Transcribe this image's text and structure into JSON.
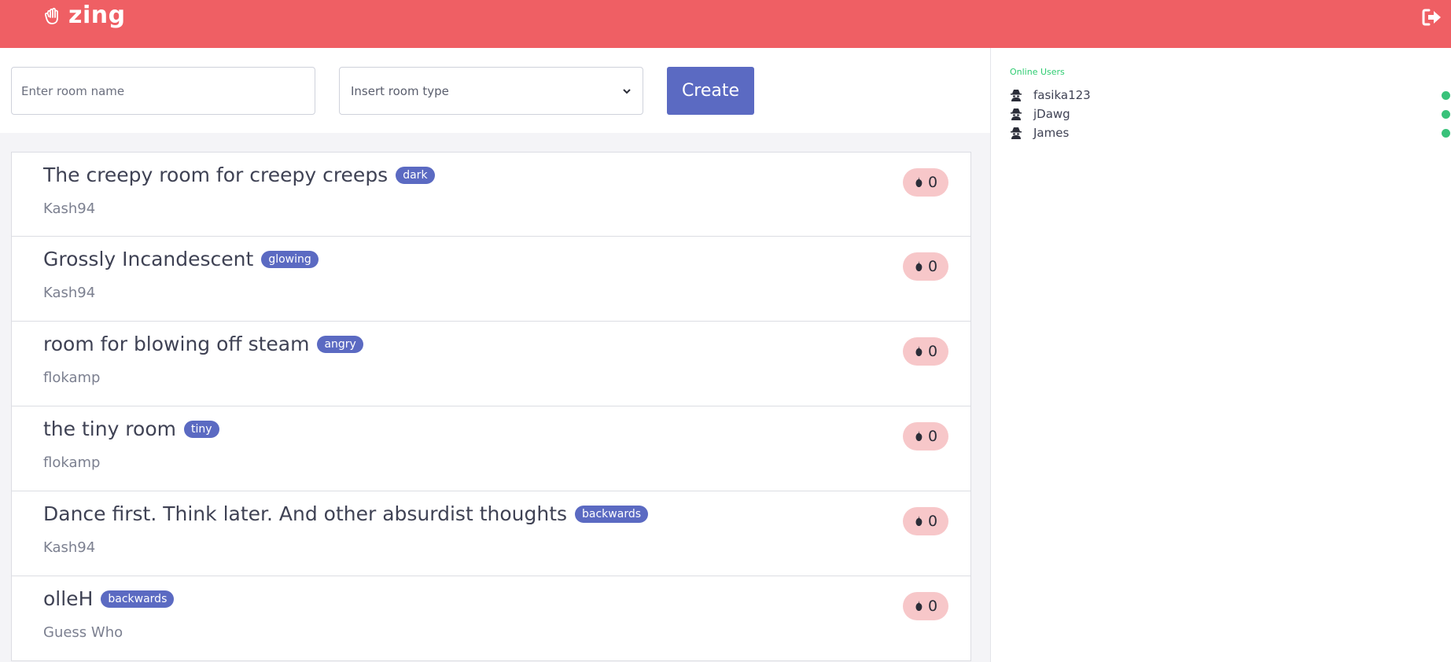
{
  "header": {
    "brand": "zing",
    "brand_color": "#ef5f64"
  },
  "form": {
    "room_name_placeholder": "Enter room name",
    "room_type_value": "Insert room type",
    "create_label": "Create"
  },
  "rooms": [
    {
      "title": "The creepy room for creepy creeps",
      "tag": "dark",
      "owner": "Kash94",
      "count": "0"
    },
    {
      "title": "Grossly Incandescent",
      "tag": "glowing",
      "owner": "Kash94",
      "count": "0"
    },
    {
      "title": "room for blowing off steam",
      "tag": "angry",
      "owner": "flokamp",
      "count": "0"
    },
    {
      "title": "the tiny room",
      "tag": "tiny",
      "owner": "flokamp",
      "count": "0"
    },
    {
      "title": "Dance first. Think later. And other absurdist thoughts",
      "tag": "backwards",
      "owner": "Kash94",
      "count": "0"
    },
    {
      "title": "olleH",
      "tag": "backwards",
      "owner": "Guess Who",
      "count": "0"
    }
  ],
  "sidebar": {
    "title": "Online Users",
    "users": [
      {
        "name": "fasika123",
        "status": "online"
      },
      {
        "name": "jDawg",
        "status": "online"
      },
      {
        "name": "James",
        "status": "online"
      }
    ]
  },
  "colors": {
    "accent": "#5b6ac2",
    "online": "#39c27a",
    "badge": "#f7c7c9"
  },
  "icons": {
    "brand": "hand-icon",
    "logout": "sign-out-icon",
    "room_count": "pepper-icon",
    "user": "spy-icon"
  }
}
